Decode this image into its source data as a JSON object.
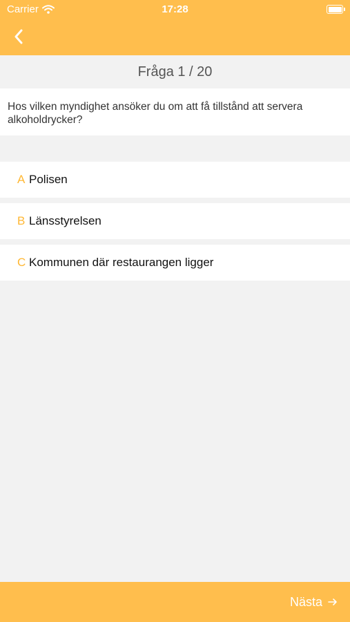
{
  "status": {
    "carrier": "Carrier",
    "time": "17:28"
  },
  "header": {
    "counter": "Fråga 1 / 20"
  },
  "question": {
    "text": "Hos vilken myndighet ansöker du om att få tillstånd att servera alkoholdrycker?"
  },
  "answers": [
    {
      "letter": "A",
      "text": "Polisen"
    },
    {
      "letter": "B",
      "text": "Länsstyrelsen"
    },
    {
      "letter": "C",
      "text": "Kommunen där restaurangen ligger"
    }
  ],
  "footer": {
    "next_label": "Nästa"
  },
  "colors": {
    "accent": "#ffbe4d",
    "letter": "#ffb733",
    "background": "#f2f2f2"
  },
  "icons": {
    "back": "chevron-left-icon",
    "next": "arrow-right-icon",
    "wifi": "wifi-icon",
    "battery": "battery-icon"
  }
}
